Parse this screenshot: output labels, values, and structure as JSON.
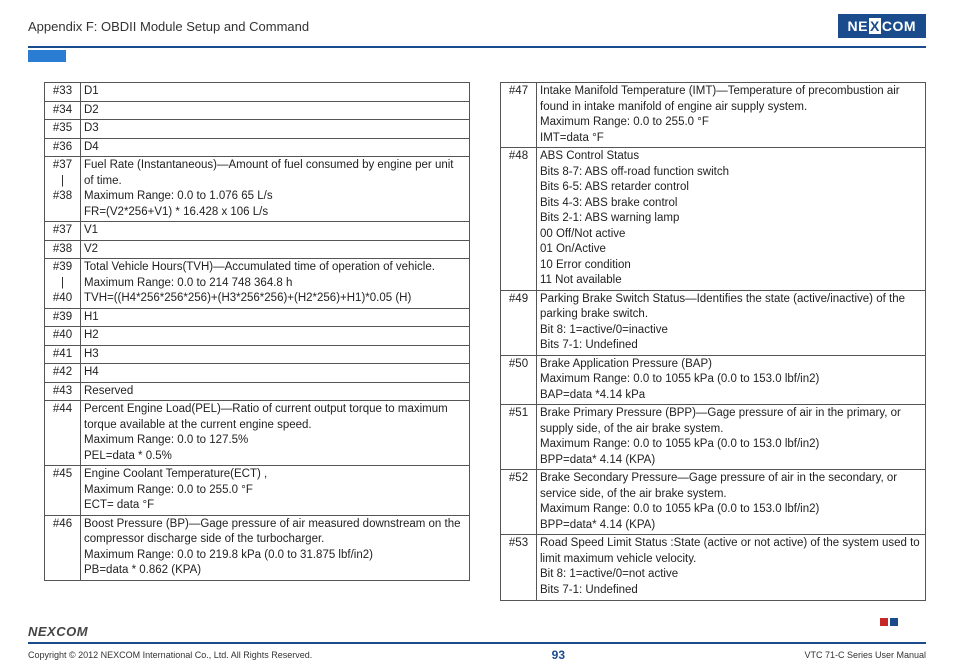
{
  "header": {
    "title": "Appendix F: OBDII Module Setup and Command",
    "logo_left": "NE",
    "logo_mid": "X",
    "logo_right": "COM"
  },
  "left_rows": [
    {
      "id": "#33",
      "lines": [
        "D1"
      ]
    },
    {
      "id": "#34",
      "lines": [
        "D2"
      ]
    },
    {
      "id": "#35",
      "lines": [
        "D3"
      ]
    },
    {
      "id": "#36",
      "lines": [
        "D4"
      ]
    },
    {
      "id": "#37\n|\n#38",
      "lines": [
        "Fuel Rate (Instantaneous)—Amount of fuel consumed by engine per unit of time.",
        "Maximum Range: 0.0 to 1.076 65 L/s",
        "FR=(V2*256+V1) * 16.428 x 106 L/s"
      ]
    },
    {
      "id": "#37",
      "lines": [
        "V1"
      ]
    },
    {
      "id": "#38",
      "lines": [
        "V2"
      ]
    },
    {
      "id": "#39\n|\n#40",
      "lines": [
        "Total Vehicle Hours(TVH)—Accumulated time of operation of vehicle.",
        "Maximum Range: 0.0 to 214 748 364.8 h",
        "TVH=((H4*256*256*256)+(H3*256*256)+(H2*256)+H1)*0.05 (H)"
      ]
    },
    {
      "id": "#39",
      "lines": [
        "H1"
      ]
    },
    {
      "id": "#40",
      "lines": [
        "H2"
      ]
    },
    {
      "id": "#41",
      "lines": [
        "H3"
      ]
    },
    {
      "id": "#42",
      "lines": [
        "H4"
      ]
    },
    {
      "id": "#43",
      "lines": [
        "Reserved"
      ]
    },
    {
      "id": "#44",
      "lines": [
        "Percent Engine Load(PEL)—Ratio of current output torque to maximum torque available at the current engine speed.",
        "Maximum Range: 0.0 to 127.5%",
        "PEL=data * 0.5%"
      ]
    },
    {
      "id": "#45",
      "lines": [
        "Engine Coolant Temperature(ECT) ,",
        "Maximum Range: 0.0 to 255.0 °F",
        "ECT= data °F"
      ]
    },
    {
      "id": "#46",
      "lines": [
        "Boost Pressure (BP)—Gage pressure of air measured downstream on the compressor discharge side of the turbocharger.",
        "Maximum Range: 0.0 to 219.8 kPa (0.0 to 31.875 lbf/in2)",
        "PB=data * 0.862 (KPA)"
      ]
    }
  ],
  "right_rows": [
    {
      "id": "#47",
      "lines": [
        "Intake Manifold Temperature (IMT)—Temperature of precombustion air found in intake manifold of engine air supply system.",
        "Maximum Range: 0.0 to 255.0 °F",
        "IMT=data °F"
      ]
    },
    {
      "id": "#48",
      "lines": [
        "ABS Control Status",
        "Bits 8-7: ABS off-road function switch",
        "Bits 6-5: ABS retarder control",
        "Bits 4-3: ABS brake control",
        "Bits 2-1: ABS warning lamp",
        "00 Off/Not active",
        "01 On/Active",
        "10 Error condition",
        "11 Not available"
      ]
    },
    {
      "id": "#49",
      "lines": [
        "Parking Brake Switch Status—Identifies the state (active/inactive) of the parking brake switch.",
        "Bit 8: 1=active/0=inactive",
        "Bits 7-1: Undefined"
      ]
    },
    {
      "id": "#50",
      "lines": [
        "Brake Application Pressure (BAP)",
        "Maximum Range: 0.0 to 1055 kPa (0.0 to 153.0 lbf/in2)",
        "BAP=data *4.14 kPa"
      ]
    },
    {
      "id": "#51",
      "lines": [
        "Brake Primary Pressure (BPP)—Gage pressure of air in the primary, or supply side, of the air brake system.",
        "Maximum Range: 0.0 to 1055 kPa (0.0 to 153.0 lbf/in2)",
        "BPP=data* 4.14 (KPA)"
      ]
    },
    {
      "id": "#52",
      "lines": [
        "Brake Secondary Pressure—Gage pressure of air in the secondary, or service side, of the air brake system.",
        "Maximum Range: 0.0 to 1055 kPa (0.0 to 153.0 lbf/in2)",
        "BPP=data* 4.14 (KPA)"
      ]
    },
    {
      "id": "#53",
      "lines": [
        "Road Speed Limit Status :State (active or not active) of the system used to limit maximum vehicle velocity.",
        "Bit 8: 1=active/0=not active",
        "Bits 7-1: Undefined"
      ]
    }
  ],
  "footer": {
    "brand": "NEXCOM",
    "copyright": "Copyright © 2012 NEXCOM International Co., Ltd. All Rights Reserved.",
    "page": "93",
    "manual": "VTC 71-C Series User Manual"
  }
}
